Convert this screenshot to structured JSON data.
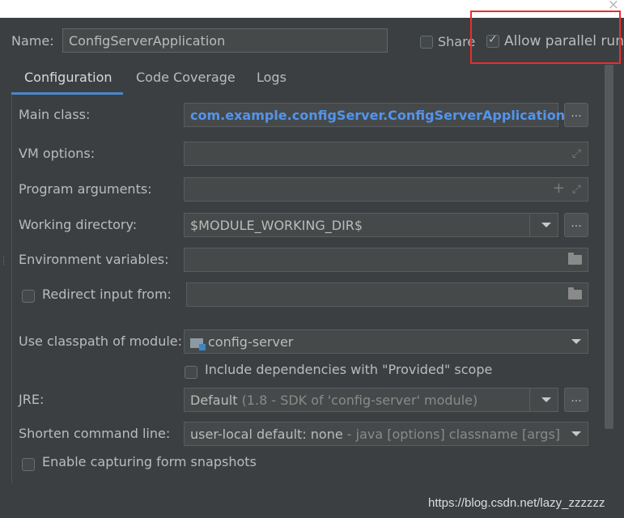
{
  "dialog": {
    "name_label": "Name:",
    "name_value": "ConfigServerApplication",
    "share_label": "Share",
    "allow_parallel_label": "Allow parallel run",
    "close_glyph": "×"
  },
  "tabs": [
    {
      "label": "Configuration",
      "active": true
    },
    {
      "label": "Code Coverage",
      "active": false
    },
    {
      "label": "Logs",
      "active": false
    }
  ],
  "form": {
    "main_class": {
      "label": "Main class:",
      "value": "com.example.configServer.ConfigServerApplication"
    },
    "vm_options": {
      "label": "VM options:",
      "value": ""
    },
    "program_arguments": {
      "label": "Program arguments:",
      "value": ""
    },
    "working_directory": {
      "label": "Working directory:",
      "value": "$MODULE_WORKING_DIR$"
    },
    "environment_variables": {
      "label": "Environment variables:",
      "value": ""
    },
    "redirect_input": {
      "label": "Redirect input from:",
      "value": ""
    },
    "classpath_module": {
      "label": "Use classpath of module:",
      "value": "config-server"
    },
    "include_provided": {
      "label": "Include dependencies with \"Provided\" scope"
    },
    "jre": {
      "label": "JRE:",
      "value": "Default",
      "detail": "(1.8 - SDK of 'config-server' module)"
    },
    "shorten_cmd": {
      "label": "Shorten command line:",
      "value": "user-local default: none",
      "detail": "- java [options] classname [args]"
    },
    "enable_snapshots": {
      "label": "Enable capturing form snapshots"
    },
    "dots": "..."
  },
  "watermark": "https://blog.csdn.net/lazy_zzzzzz",
  "colors": {
    "background": "#3c3f41",
    "accent": "#4a88c7",
    "highlight": "#ef2b2b",
    "class_text": "#5394ec"
  }
}
